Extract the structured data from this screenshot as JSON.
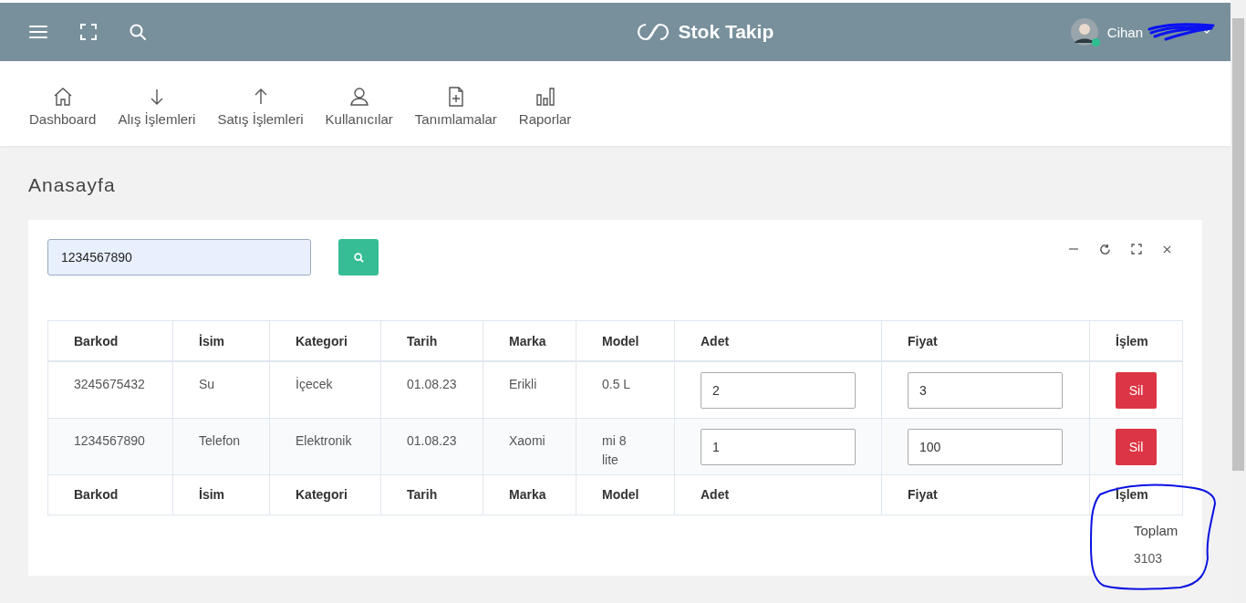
{
  "header": {
    "brand": "Stok Takip",
    "user": {
      "name": "Cihan",
      "online": true
    }
  },
  "nav": [
    {
      "label": "Dashboard"
    },
    {
      "label": "Alış İşlemleri"
    },
    {
      "label": "Satış İşlemleri"
    },
    {
      "label": "Kullanıcılar"
    },
    {
      "label": "Tanımlamalar"
    },
    {
      "label": "Raporlar"
    }
  ],
  "page_title": "Anasayfa",
  "search": {
    "value": "1234567890"
  },
  "table": {
    "columns": [
      "Barkod",
      "İsim",
      "Kategori",
      "Tarih",
      "Marka",
      "Model",
      "Adet",
      "Fiyat",
      "İşlem"
    ],
    "rows": [
      {
        "cells": [
          "3245675432",
          "Su",
          "İçecek",
          "01.08.23",
          "Erikli",
          "0.5 L"
        ],
        "adet": "2",
        "fiyat": "3",
        "action": "Sil"
      },
      {
        "cells": [
          "1234567890",
          "Telefon",
          "Elektronik",
          "01.08.23",
          "Xaomi",
          "mi 8 lite"
        ],
        "adet": "1",
        "fiyat": "100",
        "action": "Sil"
      }
    ],
    "footer": [
      "Barkod",
      "İsim",
      "Kategori",
      "Tarih",
      "Marka",
      "Model",
      "Adet",
      "Fiyat",
      "İşlem"
    ]
  },
  "total": {
    "label": "Toplam",
    "value": "3103"
  }
}
